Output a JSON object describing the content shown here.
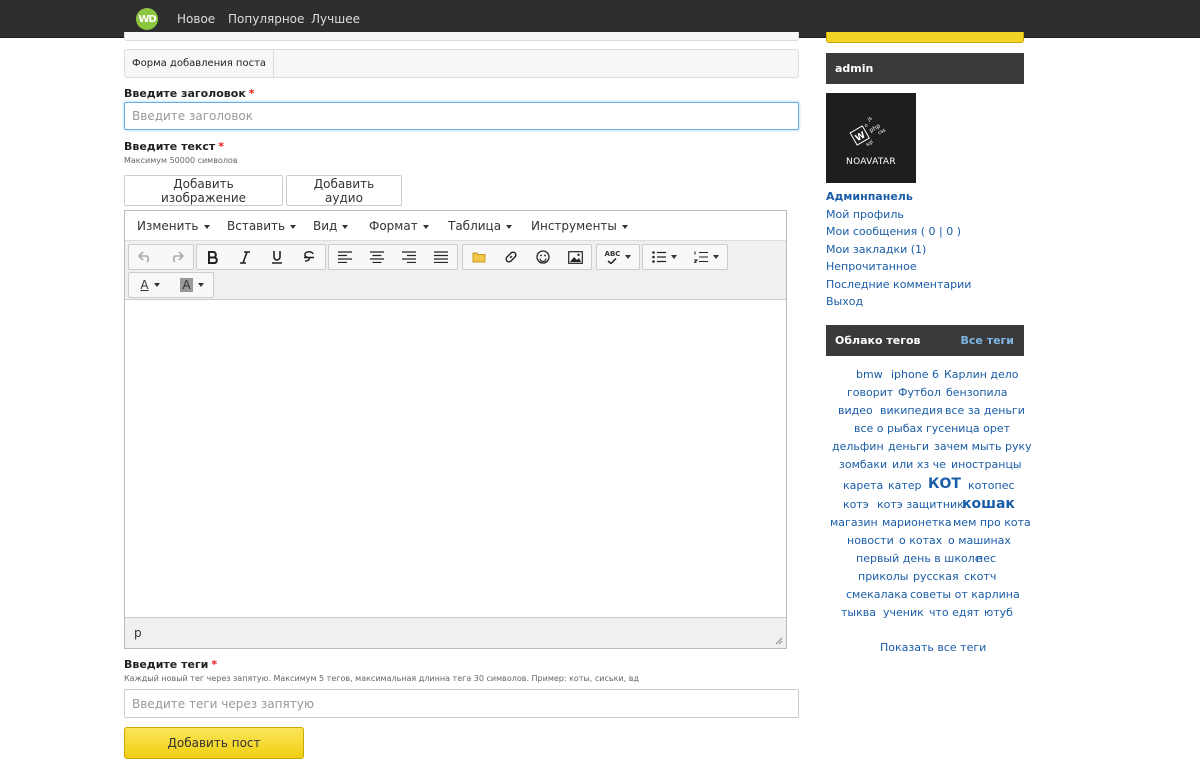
{
  "nav": {
    "logo_text": "WD",
    "links": [
      "Новое",
      "Популярное",
      "Лучшее"
    ]
  },
  "form": {
    "header_tab": "Форма добавления поста",
    "title_label": "Введите заголовок",
    "title_placeholder": "Введите заголовок",
    "text_label": "Введите текст",
    "text_hint": "Максимум 50000 символов",
    "add_image_button": "Добавить изображение",
    "add_audio_button": "Добавить аудио",
    "tags_label": "Введите теги",
    "tags_hint": "Каждый новый тег через запятую. Максимум 5 тегов, максимальная длинна тега 30 символов. Пример: коты, сиськи, вд",
    "tags_placeholder": "Введите теги через запятую",
    "submit_button": "Добавить пост",
    "required_mark": "*"
  },
  "editor": {
    "menu": [
      "Изменить",
      "Вставить",
      "Вид",
      "Формат",
      "Таблица",
      "Инструменты"
    ],
    "status_path": "p",
    "spellcheck_label": "ABC",
    "text_color_glyph": "A",
    "bg_color_glyph": "A"
  },
  "sidebar": {
    "user_name": "admin",
    "avatar_text": "NOAVATAR",
    "links": [
      "Админпанель",
      "Мой профиль",
      "Мои сообщения ( 0 | 0 )",
      "Мои закладки (1)",
      "Непрочитанное",
      "Последние комментарии",
      "Выход"
    ],
    "tags_title": "Облако тегов",
    "all_tags": "Все теги",
    "tags": [
      "bmw",
      "iphone 6",
      "Карлин дело",
      "говорит",
      "Футбол",
      "бензопила",
      "видео",
      "википедия",
      "все за деньги",
      "все о рыбах",
      "гусеница орет",
      "дельфин",
      "деньги",
      "зачем мыть руку",
      "зомбаки",
      "или хз че",
      "иностранцы",
      "карета",
      "катер",
      "КОТ",
      "котопес",
      "котэ",
      "котэ защитник",
      "кошак",
      "магазин",
      "марионетка",
      "мем про кота",
      "новости",
      "о котах",
      "о машинах",
      "первый день в школе",
      "пес",
      "приколы",
      "русская",
      "скотч",
      "смекалака",
      "советы от карлина",
      "тыква",
      "ученик",
      "что едят",
      "ютуб"
    ],
    "show_all_tags": "Показать все теги"
  },
  "colors": {
    "topbar": "#2e2e2e",
    "accent_yellow": "#f3d324",
    "link_blue": "#1a5da8",
    "required_red": "#e21b1b",
    "logo_green": "#8dc63f"
  }
}
